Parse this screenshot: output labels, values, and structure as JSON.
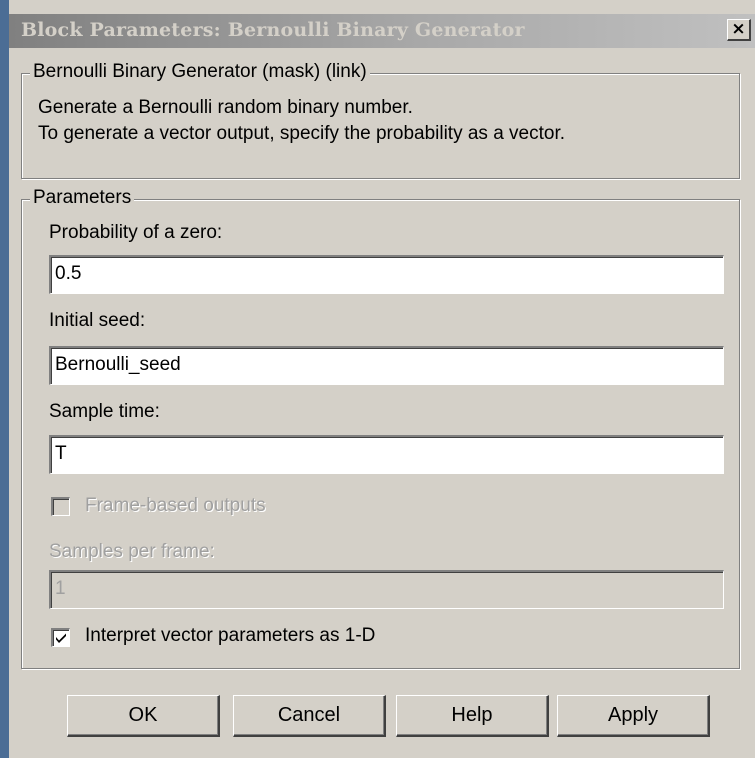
{
  "window": {
    "title": "Block Parameters: Bernoulli Binary Generator",
    "close_glyph": "×"
  },
  "description": {
    "legend": "Bernoulli Binary Generator (mask) (link)",
    "line1": "Generate a Bernoulli random binary number.",
    "line2": "To generate a vector output, specify the probability as a vector."
  },
  "parameters": {
    "legend": "Parameters",
    "probability": {
      "label": "Probability of a zero:",
      "value": "0.5"
    },
    "seed": {
      "label": "Initial seed:",
      "value": "Bernoulli_seed"
    },
    "sample_time": {
      "label": "Sample time:",
      "value": "T"
    },
    "frame_based": {
      "label": "Frame-based outputs",
      "checked": false,
      "enabled": false
    },
    "samples_per_frame": {
      "label": "Samples per frame:",
      "value": "1",
      "enabled": false
    },
    "interpret_vector": {
      "label": "Interpret vector parameters as 1-D",
      "checked": true,
      "enabled": true
    }
  },
  "buttons": {
    "ok": "OK",
    "cancel": "Cancel",
    "help": "Help",
    "apply": "Apply"
  },
  "colors": {
    "face": "#d4d0c8",
    "left_accent": "#4b6d95",
    "disabled_text": "#a0a0a0"
  }
}
